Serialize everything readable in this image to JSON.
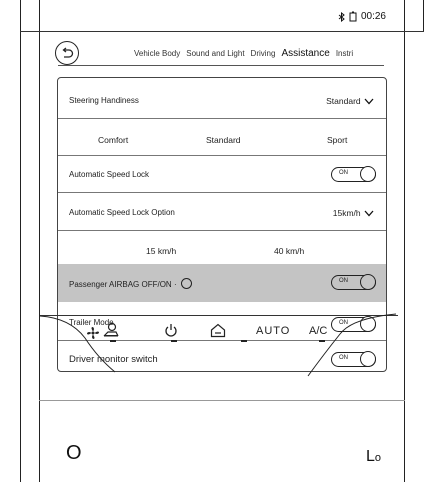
{
  "status_bar": {
    "bluetooth_icon": "bluetooth-icon",
    "phone_icon": "phone-icon",
    "time": "00:26"
  },
  "nav": {
    "back_icon": "back-icon",
    "tabs": [
      {
        "label": "Vehicle Body",
        "active": false
      },
      {
        "label": "Sound and Light",
        "active": false
      },
      {
        "label": "Driving",
        "active": false
      },
      {
        "label": "Assistance",
        "active": true
      },
      {
        "label": "Instri",
        "active": false
      }
    ]
  },
  "settings": {
    "steering": {
      "label": "Steering Handiness",
      "value": "Standard",
      "options": [
        "Comfort",
        "Standard",
        "Sport"
      ]
    },
    "auto_speed_lock": {
      "label": "Automatic Speed Lock",
      "toggle_text": "ON",
      "state": "on"
    },
    "auto_speed_lock_option": {
      "label": "Automatic Speed Lock Option",
      "value": "15km/h",
      "options": [
        "15 km/h",
        "40 km/h"
      ]
    },
    "airbag": {
      "label": "Passenger AIRBAG OFF/ON",
      "suffix": "·",
      "toggle_text": "ON",
      "state": "on"
    },
    "trailer_mode": {
      "label": "Trailer Mode",
      "toggle_text": "ON",
      "state": "on"
    },
    "driver_monitor": {
      "label": "Driver monitor switch",
      "toggle_text": "ON",
      "state": "on"
    }
  },
  "climate_bar": {
    "fan_icon": "fan-icon",
    "seat_icon": "seat-heat-icon",
    "power_icon": "power-icon",
    "recirculation_icon": "recirculation-icon",
    "auto_label": "AUTO",
    "ac_label": "A/C"
  },
  "bottom": {
    "left_value": "O",
    "right_value": "L",
    "right_suffix": "o"
  }
}
